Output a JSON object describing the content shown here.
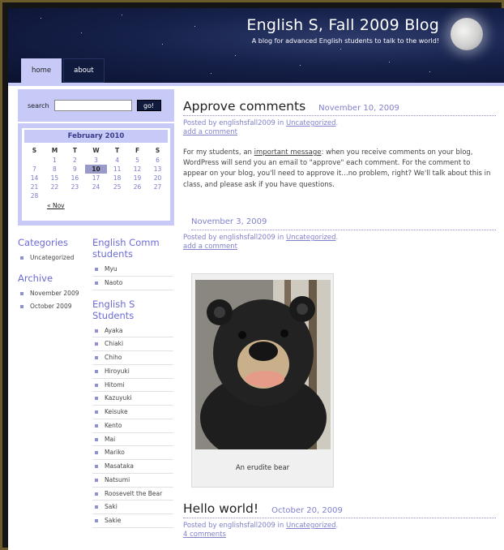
{
  "header": {
    "blog_title": "English S, Fall 2009 Blog",
    "tagline": "A blog for advanced English students to talk to the world!"
  },
  "nav": {
    "tabs": [
      "home",
      "about"
    ],
    "active": "home"
  },
  "search": {
    "label": "search",
    "value": "",
    "button_label": "go!"
  },
  "calendar": {
    "title": "February 2010",
    "days": [
      "S",
      "M",
      "T",
      "W",
      "T",
      "F",
      "S"
    ],
    "rows": [
      [
        "",
        "1",
        "2",
        "3",
        "4",
        "5",
        "6"
      ],
      [
        "7",
        "8",
        "9",
        "10",
        "11",
        "12",
        "13"
      ],
      [
        "14",
        "15",
        "16",
        "17",
        "18",
        "19",
        "20"
      ],
      [
        "21",
        "22",
        "23",
        "24",
        "25",
        "26",
        "27"
      ],
      [
        "28",
        "",
        "",
        "",
        "",
        "",
        ""
      ]
    ],
    "today": "10",
    "prev_link": "« Nov"
  },
  "sidebar": {
    "categories_title": "Categories",
    "categories": [
      "Uncategorized"
    ],
    "archive_title": "Archive",
    "archive": [
      "November 2009",
      "October 2009"
    ],
    "comm_title": "English Comm students",
    "comm_students": [
      "Myu",
      "Naoto"
    ],
    "s_title": "English S Students",
    "s_students": [
      "Ayaka",
      "Chiaki",
      "Chiho",
      "Hiroyuki",
      "Hitomi",
      "Kazuyuki",
      "Keisuke",
      "Kento",
      "Mai",
      "Mariko",
      "Masataka",
      "Natsumi",
      "Roosevelt the Bear",
      "Saki",
      "Sakie"
    ]
  },
  "posts": [
    {
      "title": "Approve comments",
      "date": "November 10, 2009",
      "meta_prefix": "Posted by englishsfall2009 in ",
      "category": "Uncategorized",
      "comment_link": "add a comment",
      "body_before": "For my students, an ",
      "body_link": "important message",
      "body_after": ": when you receive comments on your blog, WordPress will send you an email to \"approve\" each comment.  For the comment to appear on your blog, you'll need to approve it…no problem, right? We'll talk about this in class, and please ask if you have questions."
    },
    {
      "title": "",
      "date": "November 3, 2009",
      "meta_prefix": "Posted by englishsfall2009 in ",
      "category": "Uncategorized",
      "comment_link": "add a comment",
      "photo_caption": "An erudite bear"
    },
    {
      "title": "Hello world!",
      "date": "October 20, 2009",
      "meta_prefix": "Posted by englishsfall2009 in ",
      "category": "Uncategorized",
      "comment_link": "4 comments"
    }
  ],
  "colors": {
    "accent": "#8181cc",
    "sidebar_bg": "#c7c9f6",
    "header_bg": "#16214a"
  }
}
